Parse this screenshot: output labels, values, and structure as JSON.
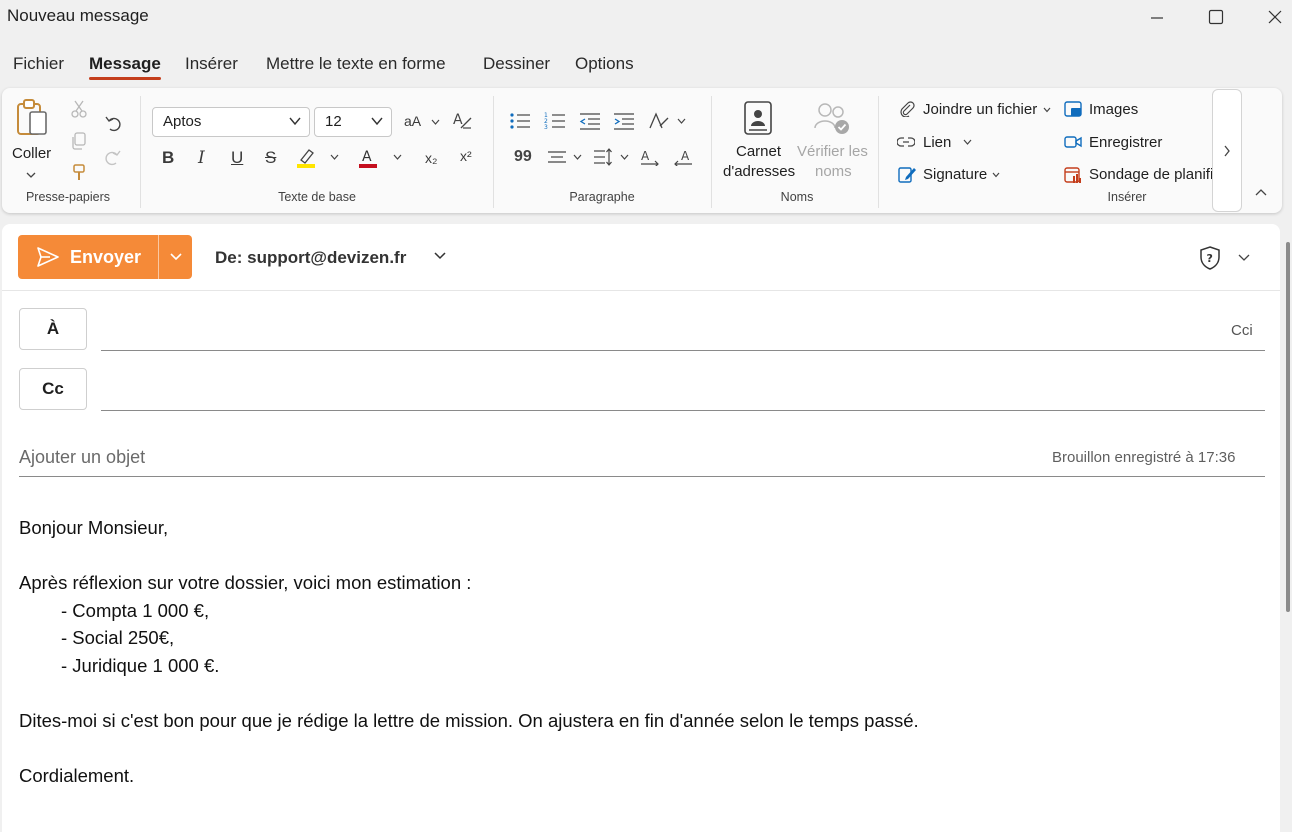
{
  "window": {
    "title": "Nouveau message"
  },
  "menu": {
    "tabs": [
      "Fichier",
      "Message",
      "Insérer",
      "Mettre le texte en forme",
      "Dessiner",
      "Options"
    ],
    "active": "Message"
  },
  "ribbon": {
    "clipboard": {
      "paste_label": "Coller",
      "group_label": "Presse-papiers"
    },
    "basic_text": {
      "font_name": "Aptos",
      "font_size": "12",
      "group_label": "Texte de base",
      "font_grow_label": "aA",
      "subscript_label": "x₂",
      "superscript_label": "x²",
      "bold": "B",
      "italic": "I",
      "underline": "U",
      "strike": "S",
      "highlight_color": "#ffe500",
      "font_color": "#c50f1f"
    },
    "paragraph": {
      "group_label": "Paragraphe"
    },
    "names": {
      "address_book_line1": "Carnet",
      "address_book_line2": "d'adresses",
      "check_names_line1": "Vérifier les",
      "check_names_line2": "noms",
      "group_label": "Noms"
    },
    "insert": {
      "attach_file": "Joindre un fichier",
      "link": "Lien",
      "signature": "Signature",
      "images": "Images",
      "record": "Enregistrer",
      "poll": "Sondage de planifi",
      "group_label": "Insérer"
    }
  },
  "compose": {
    "send_label": "Envoyer",
    "from_label": "De: support@devizen.fr",
    "to_label": "À",
    "cc_label": "Cc",
    "bcc_label": "Cci",
    "subject_placeholder": "Ajouter un objet",
    "draft_status": "Brouillon enregistré à 17:36",
    "body": {
      "greeting": "Bonjour Monsieur,",
      "intro": "Après réflexion sur votre dossier, voici mon estimation :",
      "items": [
        "- Compta 1 000 €,",
        "- Social 250€,",
        "- Juridique 1 000 €."
      ],
      "request": "Dites-moi si c'est bon pour que je rédige la lettre de mission. On ajustera en fin d'année selon le temps passé.",
      "closing": "Cordialement."
    }
  },
  "colors": {
    "accent_send": "#f58a38",
    "active_tab_underline": "#c43e1c"
  }
}
